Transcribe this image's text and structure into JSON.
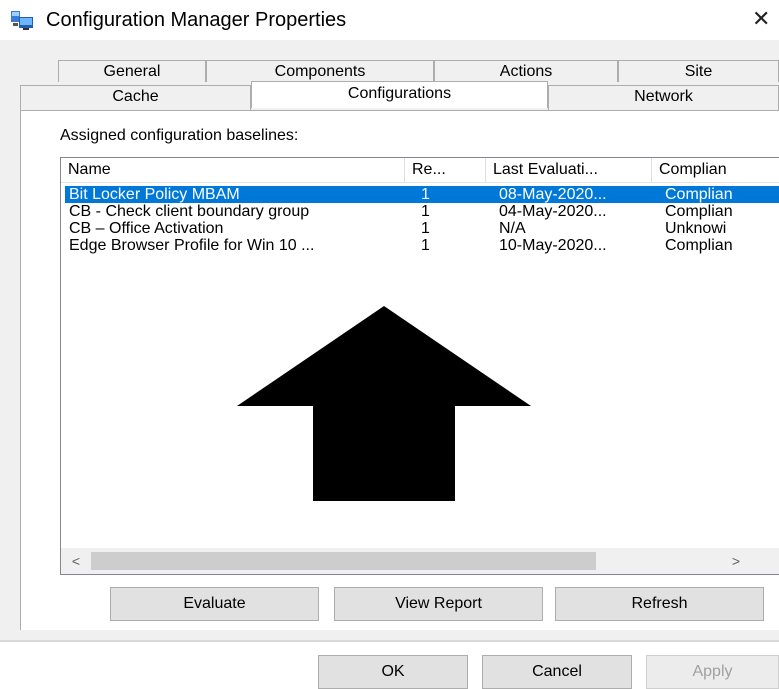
{
  "window": {
    "title": "Configuration Manager Properties",
    "close_glyph": "✕",
    "icon": "configuration-manager-icon"
  },
  "tabs": {
    "row_back": [
      "General",
      "Components",
      "Actions",
      "Site"
    ],
    "row_front": [
      "Cache",
      "Configurations",
      "Network"
    ],
    "selected": "Configurations"
  },
  "section_label": "Assigned configuration baselines:",
  "list": {
    "columns": [
      "Name",
      "Re...",
      "Last Evaluati...",
      "Complian"
    ],
    "rows": [
      {
        "name": "Bit Locker Policy MBAM",
        "revision": "1",
        "last_evaluation": "08-May-2020...",
        "compliance": "Complian",
        "selected": true
      },
      {
        "name": "CB - Check client boundary group",
        "revision": "1",
        "last_evaluation": "04-May-2020...",
        "compliance": "Complian",
        "selected": false
      },
      {
        "name": "CB – Office Activation",
        "revision": "1",
        "last_evaluation": "N/A",
        "compliance": "Unknowi",
        "selected": false
      },
      {
        "name": "Edge Browser Profile for Win 10 ...",
        "revision": "1",
        "last_evaluation": "10-May-2020...",
        "compliance": "Complian",
        "selected": false
      }
    ],
    "scroll_left_glyph": "<",
    "scroll_right_glyph": ">"
  },
  "buttons": {
    "evaluate": "Evaluate",
    "view_report": "View Report",
    "refresh": "Refresh"
  },
  "dialog_buttons": {
    "ok": "OK",
    "cancel": "Cancel",
    "apply": "Apply"
  },
  "colors": {
    "selection": "#0078d7",
    "arrow": "#000000"
  }
}
